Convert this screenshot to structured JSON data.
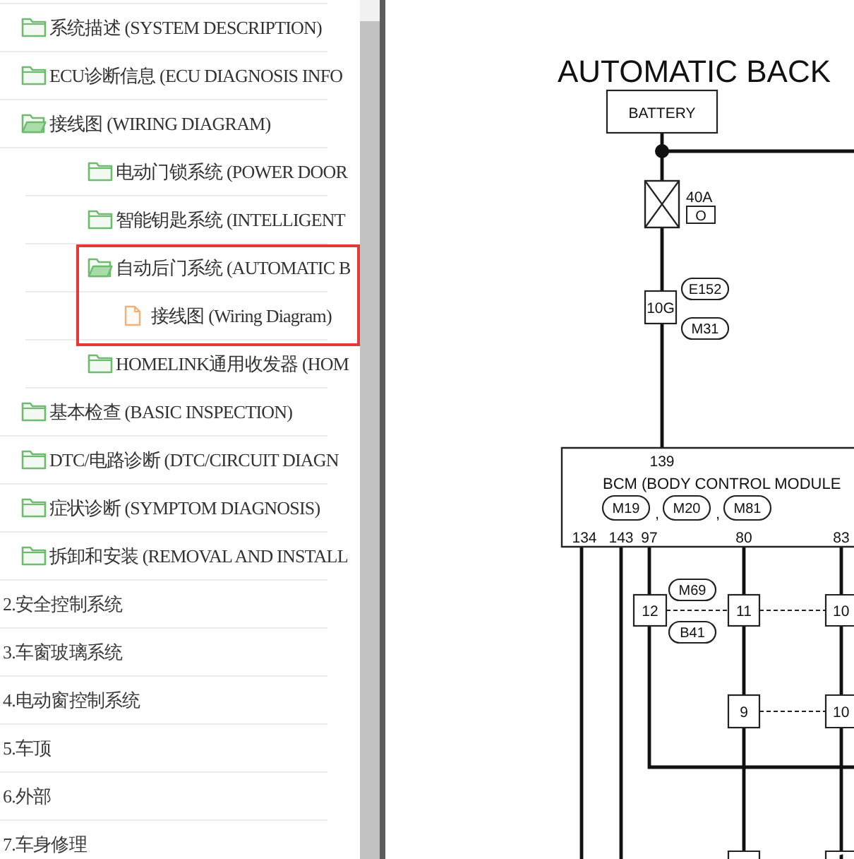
{
  "tree": [
    {
      "children": [
        {
          "kind": "folder",
          "label": "系统描述 (SYSTEM DESCRIPTION)",
          "expanded": false
        },
        {
          "kind": "folder",
          "label": "ECU诊断信息 (ECU DIAGNOSIS INFO",
          "expanded": false
        },
        {
          "kind": "folder",
          "label": "接线图 (WIRING DIAGRAM)",
          "expanded": true,
          "children": [
            {
              "kind": "folder",
              "label": "电动门锁系统 (POWER DOOR",
              "expanded": false,
              "highlighted": false
            },
            {
              "kind": "folder",
              "label": "智能钥匙系统 (INTELLIGENT",
              "expanded": false,
              "highlighted": false
            },
            {
              "kind": "folder",
              "label": "自动后门系统 (AUTOMATIC B",
              "expanded": true,
              "highlighted": true,
              "children": [
                {
                  "kind": "page",
                  "label": "接线图 (Wiring Diagram)"
                }
              ]
            },
            {
              "kind": "folder",
              "label": "HOMELINK通用收发器 (HOM",
              "expanded": false,
              "highlighted": false
            }
          ]
        },
        {
          "kind": "folder",
          "label": "基本检查 (BASIC INSPECTION)",
          "expanded": false
        },
        {
          "kind": "folder",
          "label": "DTC/电路诊断 (DTC/CIRCUIT DIAGN",
          "expanded": false
        },
        {
          "kind": "folder",
          "label": "症状诊断 (SYMPTOM DIAGNOSIS)",
          "expanded": false
        },
        {
          "kind": "folder",
          "label": "拆卸和安装 (REMOVAL AND INSTALL",
          "expanded": false
        }
      ]
    },
    {
      "kind": "section",
      "label": "2.安全控制系统"
    },
    {
      "kind": "section",
      "label": "3.车窗玻璃系统"
    },
    {
      "kind": "section",
      "label": "4.电动窗控制系统"
    },
    {
      "kind": "section",
      "label": "5.车顶"
    },
    {
      "kind": "section",
      "label": "6.外部"
    },
    {
      "kind": "section",
      "label": "7.车身修理"
    }
  ],
  "diagram": {
    "title": "AUTOMATIC BACK",
    "power_source": "BATTERY",
    "fuse": {
      "rating": "40A",
      "location": "O"
    },
    "harness_connectors": [
      {
        "terminal": "10G",
        "codes": [
          "E152",
          "M31"
        ]
      },
      {
        "terminal": "12",
        "codes": [
          "M69",
          "B41"
        ]
      },
      {
        "terminal": "11"
      },
      {
        "terminal": "10"
      },
      {
        "terminal": "9"
      },
      {
        "terminal": "10"
      }
    ],
    "module": {
      "terminal_in": "139",
      "name": "BCM (BODY CONTROL MODULE",
      "connector_codes": [
        "M19",
        "M20",
        "M81"
      ],
      "separators": [
        ",",
        ","
      ],
      "terminals_out": [
        "134",
        "143",
        "97",
        "80",
        "83"
      ]
    }
  }
}
